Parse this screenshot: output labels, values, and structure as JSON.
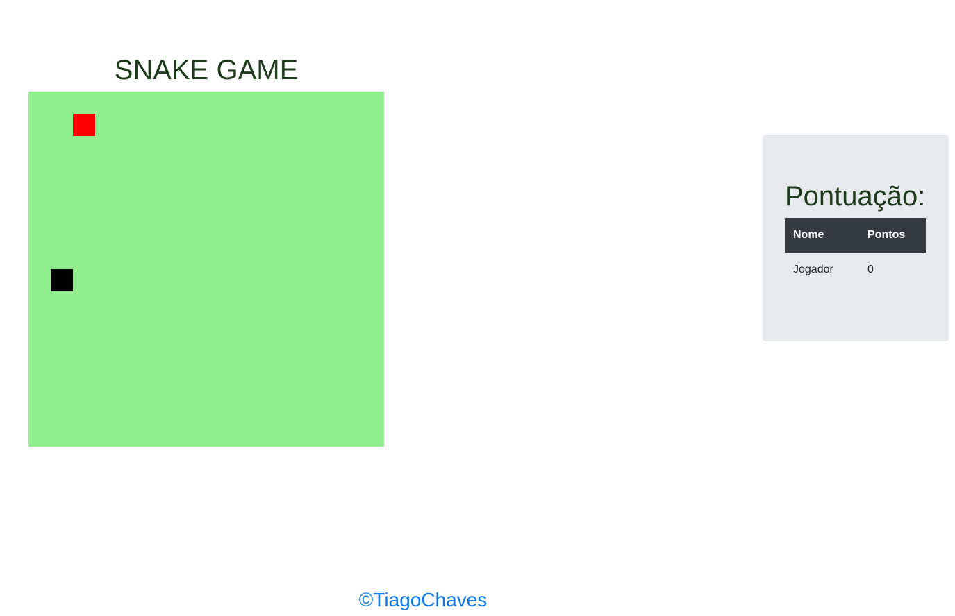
{
  "title": "SNAKE GAME",
  "board": {
    "background_color": "#90ee90",
    "grid_cells": 16,
    "food": {
      "col": 2,
      "row": 1,
      "color": "#ff0000"
    },
    "snake": [
      {
        "col": 1,
        "row": 8,
        "color": "#000000"
      }
    ]
  },
  "scoreboard": {
    "heading": "Pontuação:",
    "columns": [
      "Nome",
      "Pontos"
    ],
    "rows": [
      {
        "name": "Jogador",
        "points": "0"
      }
    ]
  },
  "footer": {
    "credit": "©TiagoChaves",
    "color": "#0d7ae8"
  }
}
